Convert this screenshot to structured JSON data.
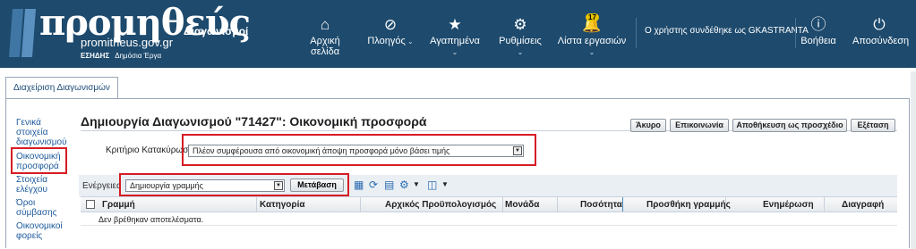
{
  "header": {
    "logo_word": "προμηθεύς",
    "logo_section": "Διαγωνισμοί",
    "logo_site": "promitheus.gov.gr",
    "logo_esidis": "ΕΣΗΔΗΣ",
    "logo_public_works": "Δημόσια Έργα",
    "nav": [
      {
        "label": "Αρχική σελίδα",
        "icon": "home-icon"
      },
      {
        "label": "Πλοηγός",
        "icon": "navigator-icon"
      },
      {
        "label": "Αγαπημένα",
        "icon": "star-icon"
      },
      {
        "label": "Ρυθμίσεις",
        "icon": "gear-icon"
      },
      {
        "label": "Λίστα εργασιών",
        "icon": "bell-icon",
        "badge": "17"
      }
    ],
    "user_status": "Ο χρήστης συνδέθηκε ως GKASTRANTA",
    "help_label": "Βοήθεια",
    "logout_label": "Αποσύνδεση"
  },
  "tabs": [
    {
      "label": "Διαχείριση Διαγωνισμών"
    }
  ],
  "sidebar": {
    "items": [
      {
        "label_lines": [
          "Γενικά",
          "στοιχεία",
          "διαγωνισμού"
        ]
      },
      {
        "label_lines": [
          "Οικονομική",
          "προσφορά"
        ],
        "selected": true
      },
      {
        "label_lines": [
          "Στοιχεία",
          "ελέγχου"
        ]
      },
      {
        "label_lines": [
          "Όροι",
          "σύμβασης"
        ]
      },
      {
        "label_lines": [
          "Οικονομικοί",
          "φορείς"
        ]
      }
    ]
  },
  "main": {
    "title": "Δημιουργία Διαγωνισμού \"71427\": Οικονομική προσφορά",
    "buttons": {
      "cancel": "Άκυρο",
      "contact": "Επικοινωνία",
      "save_draft": "Αποθήκευση ως προσχέδιο",
      "review": "Εξέταση"
    },
    "criterion_label": "Κριτήριο Κατακύρωσης",
    "criterion_value": "Πλέον συμφέρουσα από οικονομική άποψη προσφορά μόνο βάσει τιμής",
    "actions_label": "Ενέργειες",
    "actions_value": "Δημιουργία γραμμής",
    "go_button": "Μετάβαση",
    "table": {
      "columns": [
        "Γραμμή",
        "Κατηγορία",
        "Αρχικός Προϋπολογισμός",
        "Μονάδα",
        "Ποσότητα",
        "Προσθήκη γραμμής",
        "Ενημέρωση",
        "Διαγραφή"
      ],
      "empty_message": "Δεν βρέθηκαν αποτελέσματα."
    }
  },
  "colors": {
    "header_bg": "#1d4a6d",
    "highlight": "#d71c24",
    "link": "#1d5a9c"
  }
}
